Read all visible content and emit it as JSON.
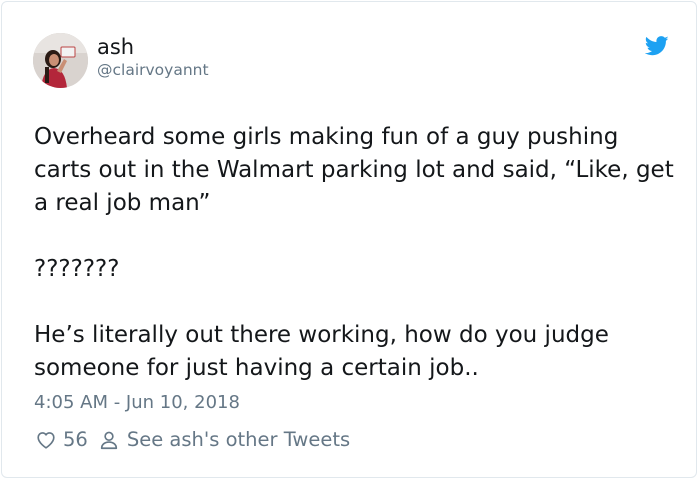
{
  "tweet": {
    "user": {
      "name": "ash",
      "handle": "@clairvoyannt",
      "avatar_icon": "profile-photo"
    },
    "brand_icon": "twitter-bird-icon",
    "brand_color": "#1da1f2",
    "paragraphs": [
      "Overheard some girls making fun of a guy pushing carts out in the Walmart parking lot and said, “Like, get a real job man”",
      "???????",
      "He’s literally out there working, how do you judge someone for just having a certain job.."
    ],
    "timestamp": "4:05 AM - Jun 10, 2018",
    "likes": "56",
    "see_more": "See ash's other Tweets"
  }
}
